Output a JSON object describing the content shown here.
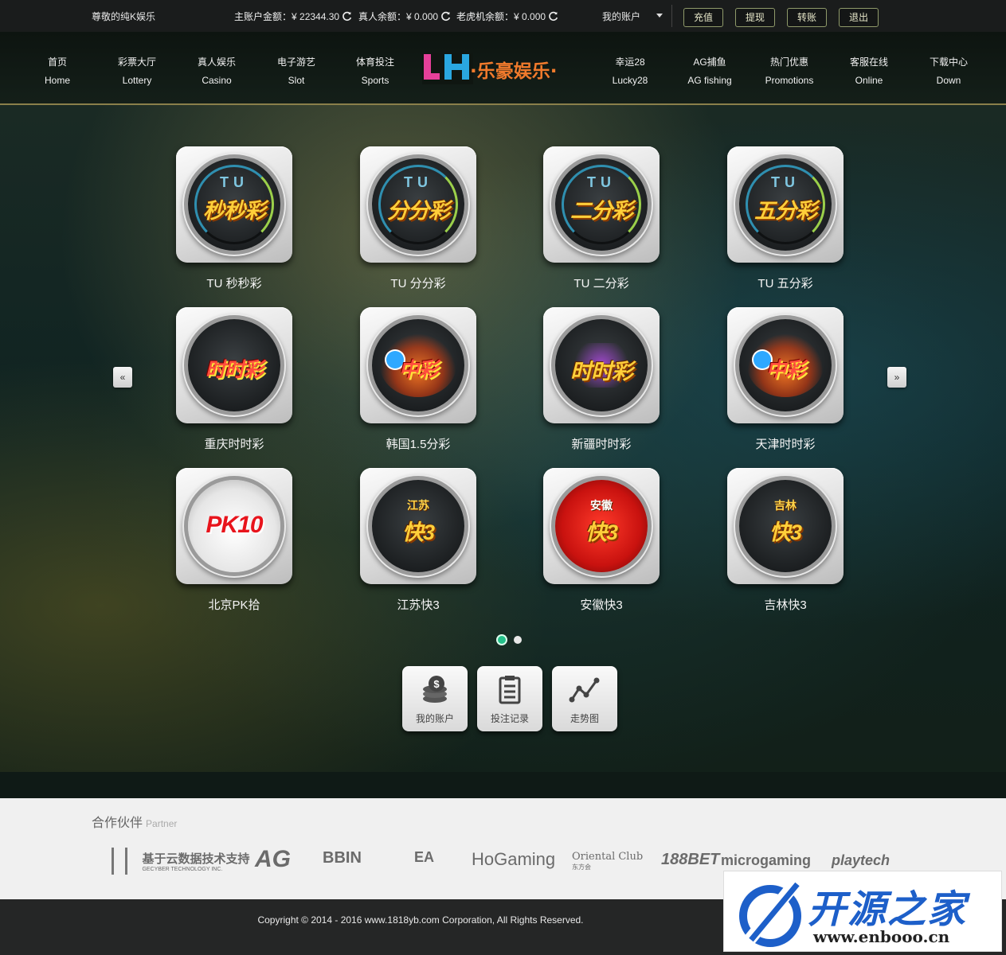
{
  "topbar": {
    "welcome": "尊敬的纯K娱乐",
    "main_balance_label": "主账户金额：",
    "main_balance": "¥ 22344.30",
    "live_balance_label": "真人余额：",
    "live_balance": "¥ 0.000",
    "slot_balance_label": "老虎机余额：",
    "slot_balance": "¥ 0.000",
    "account_menu": "我的账户",
    "buttons": [
      "充值",
      "提现",
      "转账",
      "退出"
    ]
  },
  "nav": {
    "left": [
      {
        "cn": "首页",
        "en": "Home"
      },
      {
        "cn": "彩票大厅",
        "en": "Lottery"
      },
      {
        "cn": "真人娱乐",
        "en": "Casino"
      },
      {
        "cn": "电子游艺",
        "en": "Slot"
      },
      {
        "cn": "体育投注",
        "en": "Sports"
      }
    ],
    "right": [
      {
        "cn": "幸运28",
        "en": "Lucky28"
      },
      {
        "cn": "AG捕鱼",
        "en": "AG fishing"
      },
      {
        "cn": "热门优惠",
        "en": "Promotions"
      },
      {
        "cn": "客服在线",
        "en": "Online"
      },
      {
        "cn": "下载中心",
        "en": "Down"
      }
    ],
    "logo_letters": "LH",
    "logo_text": "·乐豪娱乐·"
  },
  "games": [
    {
      "name": "TU 秒秒彩",
      "icon_text": "秒秒彩",
      "icon_top": "TU"
    },
    {
      "name": "TU 分分彩",
      "icon_text": "分分彩",
      "icon_top": "TU"
    },
    {
      "name": "TU 二分彩",
      "icon_text": "二分彩",
      "icon_top": "TU"
    },
    {
      "name": "TU 五分彩",
      "icon_text": "五分彩",
      "icon_top": "TU"
    },
    {
      "name": "重庆时时彩",
      "icon_text": "时时彩",
      "icon_top": ""
    },
    {
      "name": "韩国1.5分彩",
      "icon_text": "中彩",
      "icon_top": ""
    },
    {
      "name": "新疆时时彩",
      "icon_text": "时时彩",
      "icon_top": ""
    },
    {
      "name": "天津时时彩",
      "icon_text": "中彩",
      "icon_top": ""
    },
    {
      "name": "北京PK拾",
      "icon_text": "PK10",
      "icon_top": ""
    },
    {
      "name": "江苏快3",
      "icon_text": "快3",
      "icon_top": "江苏"
    },
    {
      "name": "安徽快3",
      "icon_text": "快3",
      "icon_top": "安徽"
    },
    {
      "name": "吉林快3",
      "icon_text": "快3",
      "icon_top": "吉林"
    }
  ],
  "carousel": {
    "prev": "«",
    "next": "»",
    "pages": 2,
    "active_page": 1
  },
  "quick": [
    {
      "label": "我的账户",
      "icon": "coins-icon"
    },
    {
      "label": "投注记录",
      "icon": "clipboard-icon"
    },
    {
      "label": "走势图",
      "icon": "trend-chart-icon"
    }
  ],
  "partners": {
    "title": "合作伙伴",
    "title_en": "Partner",
    "logos": [
      "基于云数据技术支持",
      "GECYBER TECHNOLOGY INC.",
      "AG",
      "BBIN",
      "EA",
      "HoGaming",
      "Oriental Club",
      "东方会",
      "188BET",
      "microgaming",
      "playtech"
    ]
  },
  "footer": {
    "copyright": "Copyright © 2014 - 2016 www.1818yb.com Corporation, All Rights Reserved."
  },
  "watermark": {
    "cn": "开源之家",
    "url": "www.enbooo.cn"
  },
  "colors": {
    "accent_green": "#25c08a",
    "topbar_bg": "#1a1c1c",
    "nav_border": "#8a7f4a",
    "footer_bg": "#252626"
  }
}
